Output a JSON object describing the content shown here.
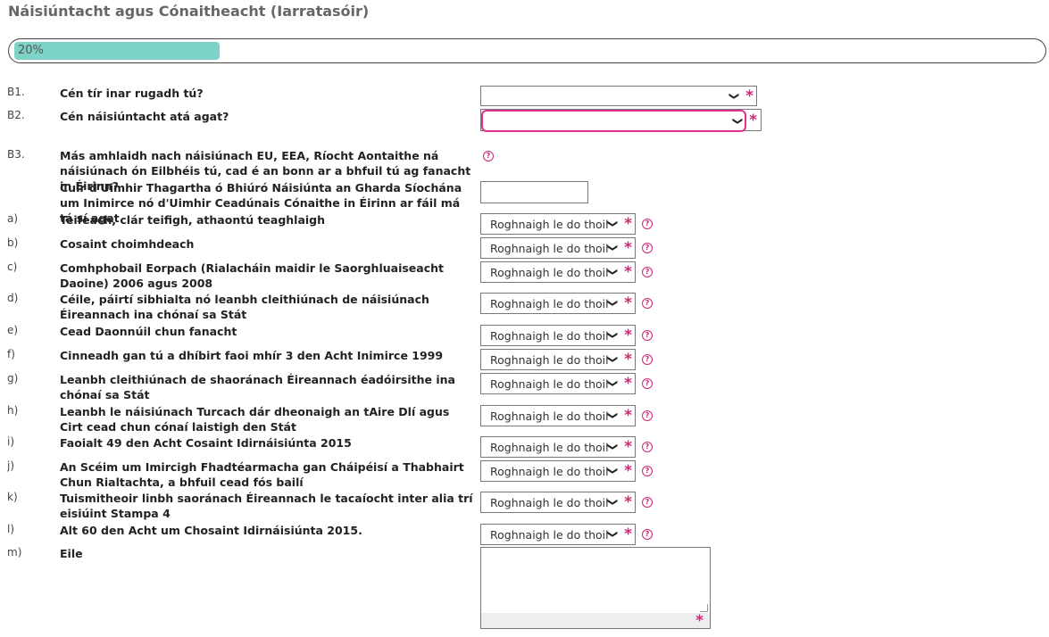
{
  "page_title": "Náisiúntacht agus Cónaitheacht (Iarratasóir)",
  "progress": {
    "label": "20%",
    "value": 20
  },
  "colors": {
    "accent": "#d0267a",
    "progress": "#7dd3c7",
    "focus": "#e0308a"
  },
  "questions": {
    "b1": {
      "num": "B1.",
      "text": "Cén tír inar rugadh tú?",
      "value": ""
    },
    "b2": {
      "num": "B2.",
      "text": "Cén náisiúntacht atá agat?",
      "value": ""
    },
    "b3": {
      "num": "B3.",
      "text": "Más amhlaidh nach náisiúnach EU, EEA, Ríocht Aontaithe ná náisiúnach ón Eilbhéis tú, cad é an bonn ar a bhfuil tú ag fanacht in Éirinn?",
      "ref_text": "Cuir d'Uimhir Thagartha ó Bhiúró Náisiúnta an Gharda Síochána um Inimirce nó d'Uimhir Ceadúnais Cónaithe in Éirinn ar fáil má tá sí agat",
      "ref_value": ""
    }
  },
  "select_placeholder": "Roghnaigh le do thoil",
  "options": [
    {
      "num": "a)",
      "text": "Teifeach, clár teifigh, athaontú teaghlaigh"
    },
    {
      "num": "b)",
      "text": "Cosaint choimhdeach"
    },
    {
      "num": "c)",
      "text": "Comhphobail Eorpach (Rialacháin maidir le Saorghluaiseacht Daoine) 2006 agus 2008"
    },
    {
      "num": "d)",
      "text": "Céile, páirtí sibhialta nó leanbh cleithiúnach de náisiúnach Éireannach ina chónaí sa Stát"
    },
    {
      "num": "e)",
      "text": "Cead Daonnúil chun fanacht"
    },
    {
      "num": "f)",
      "text": "Cinneadh gan tú a dhíbirt faoi mhír 3 den Acht Inimirce 1999"
    },
    {
      "num": "g)",
      "text": "Leanbh cleithiúnach de shaoránach Éireannach éadóirsithe ina chónaí sa Stát"
    },
    {
      "num": "h)",
      "text": "Leanbh le náisiúnach Turcach dár dheonaigh an tAire Dlí agus Cirt cead chun cónaí laistigh den Stát"
    },
    {
      "num": "i)",
      "text": "Faoialt 49 den Acht Cosaint Idirnáisiúnta 2015"
    },
    {
      "num": "j)",
      "text": "An Scéim um Imircigh Fhadtéarmacha gan Cháipéisí a Thabhairt Chun Rialtachta, a bhfuil cead fós bailí"
    },
    {
      "num": "k)",
      "text": "Tuismitheoir linbh saoránach Éireannach le tacaíocht inter alia trí eisiúint Stampa 4"
    },
    {
      "num": "l)",
      "text": "Alt 60 den Acht um Chosaint Idirnáisiúnta 2015."
    }
  ],
  "other": {
    "num": "m)",
    "text": "Eile",
    "value": ""
  },
  "required_mark": "*",
  "help_mark": "?"
}
